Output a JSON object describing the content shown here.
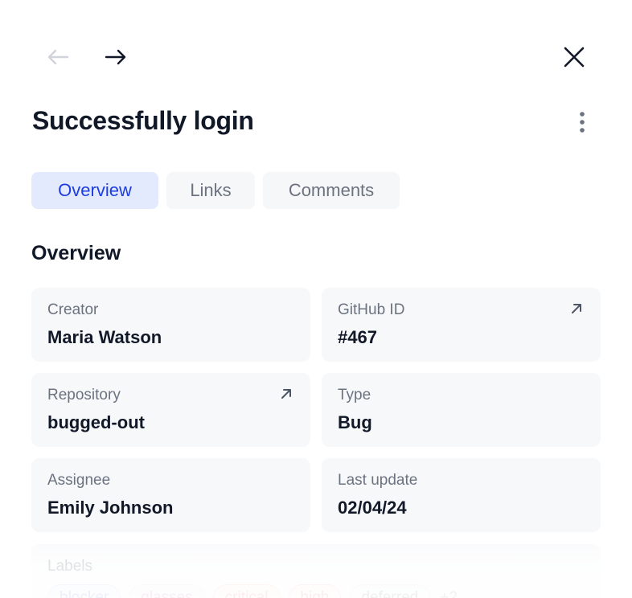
{
  "nav": {
    "back_icon": "arrow-left-icon",
    "forward_icon": "arrow-right-icon",
    "close_icon": "close-icon"
  },
  "header": {
    "title": "Successfully login",
    "more_icon": "more-vertical-icon"
  },
  "tabs": [
    {
      "label": "Overview",
      "active": true
    },
    {
      "label": "Links",
      "active": false
    },
    {
      "label": "Comments",
      "active": false
    }
  ],
  "overview": {
    "section_title": "Overview",
    "fields": [
      {
        "label": "Creator",
        "value": "Maria Watson",
        "has_link": false
      },
      {
        "label": "GitHub ID",
        "value": "#467",
        "has_link": true
      },
      {
        "label": "Repository",
        "value": "bugged-out",
        "has_link": true
      },
      {
        "label": "Type",
        "value": "Bug",
        "has_link": false
      },
      {
        "label": "Assignee",
        "value": "Emily Johnson",
        "has_link": false
      },
      {
        "label": "Last update",
        "value": "02/04/24",
        "has_link": false
      }
    ],
    "labels": {
      "label": "Labels",
      "chips": [
        "blocker",
        "glasses",
        "critical",
        "high",
        "deferred"
      ],
      "more": "+2"
    }
  },
  "colors": {
    "accent": "#1d3de0",
    "active_tab_bg": "#e3eafd",
    "card_bg": "#f7f8fa",
    "text_primary": "#111827",
    "text_secondary": "#6b7280"
  }
}
